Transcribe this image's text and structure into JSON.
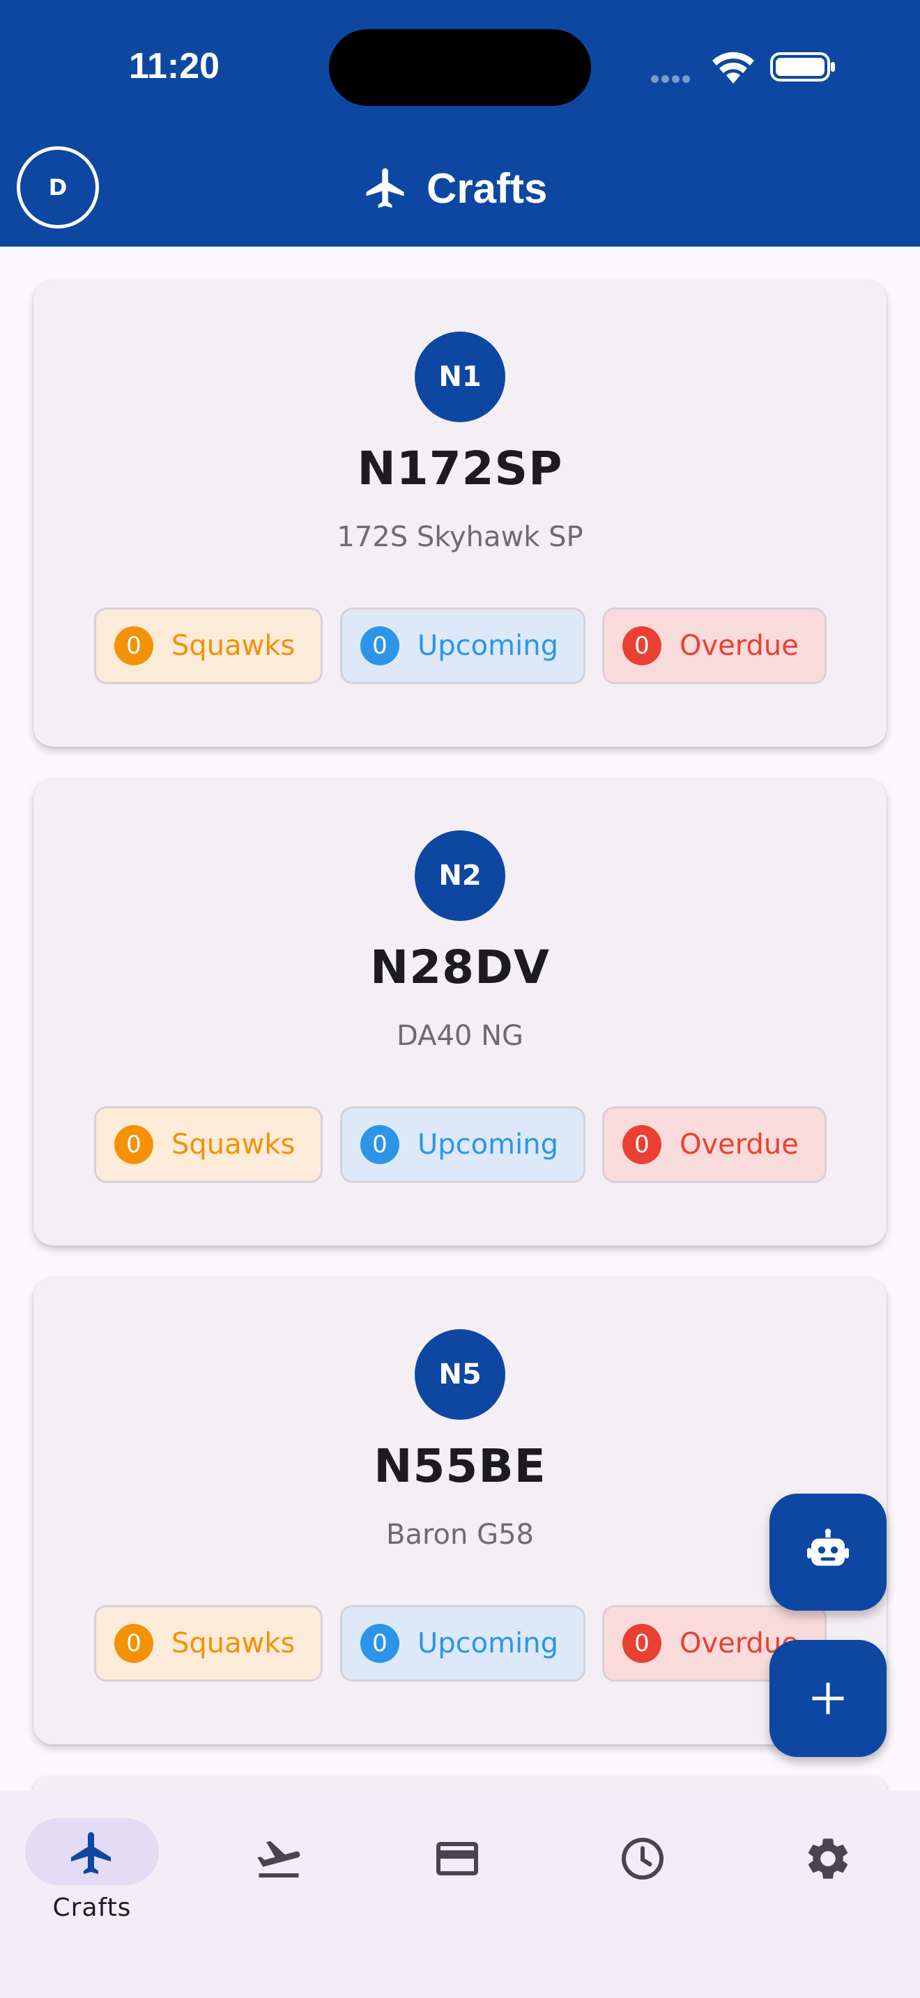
{
  "status_bar": {
    "time": "11:20"
  },
  "app_bar": {
    "avatar_initial": "D",
    "title": "Crafts",
    "title_icon": "airplane-icon"
  },
  "aircraft": [
    {
      "badge": "N1",
      "registration": "N172SP",
      "model": "172S Skyhawk SP",
      "squawks": {
        "count": "0",
        "label": "Squawks"
      },
      "upcoming": {
        "count": "0",
        "label": "Upcoming"
      },
      "overdue": {
        "count": "0",
        "label": "Overdue"
      }
    },
    {
      "badge": "N2",
      "registration": "N28DV",
      "model": "DA40 NG",
      "squawks": {
        "count": "0",
        "label": "Squawks"
      },
      "upcoming": {
        "count": "0",
        "label": "Upcoming"
      },
      "overdue": {
        "count": "0",
        "label": "Overdue"
      }
    },
    {
      "badge": "N5",
      "registration": "N55BE",
      "model": "Baron G58",
      "squawks": {
        "count": "0",
        "label": "Squawks"
      },
      "upcoming": {
        "count": "0",
        "label": "Upcoming"
      },
      "overdue": {
        "count": "0",
        "label": "Overdue"
      }
    }
  ],
  "fabs": [
    {
      "icon": "robot-icon"
    },
    {
      "icon": "plus-icon"
    }
  ],
  "bottom_nav": {
    "items": [
      {
        "label": "Crafts",
        "icon": "airplane-icon",
        "active": true
      },
      {
        "icon": "flight-takeoff-icon"
      },
      {
        "icon": "credit-card-icon"
      },
      {
        "icon": "clock-icon"
      },
      {
        "icon": "gear-icon"
      }
    ]
  },
  "colors": {
    "primary": "#0d47a1",
    "squawks": "#f39206",
    "upcoming": "#2c95e8",
    "overdue": "#ea4032"
  }
}
